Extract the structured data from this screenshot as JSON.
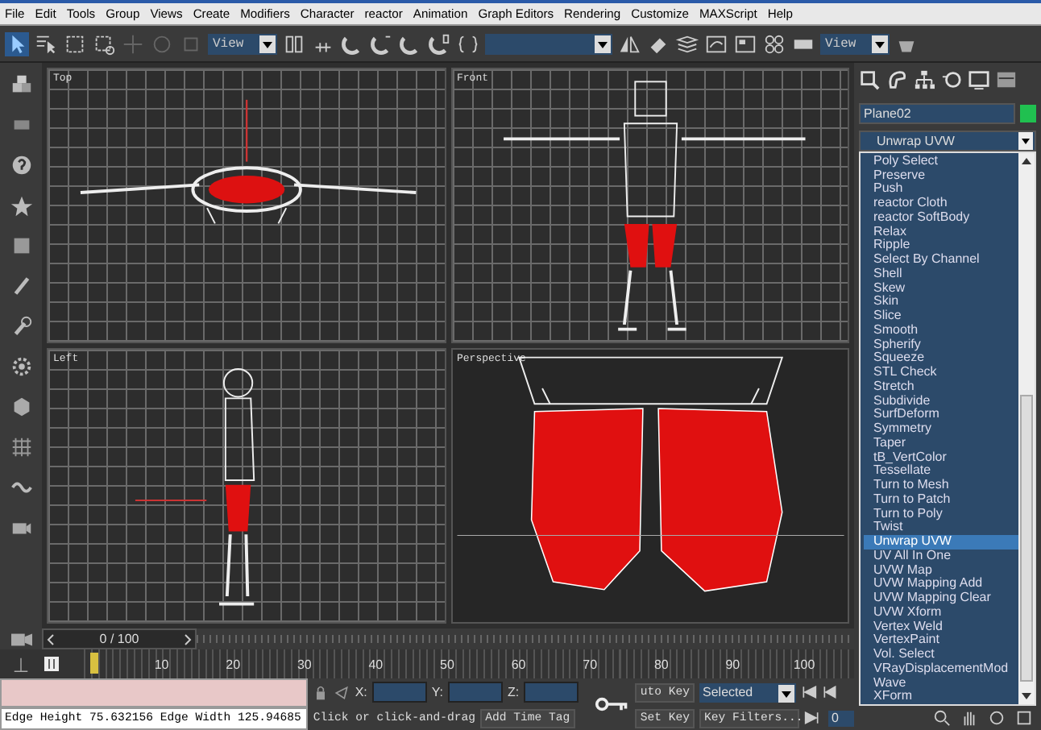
{
  "menu": [
    "File",
    "Edit",
    "Tools",
    "Group",
    "Views",
    "Create",
    "Modifiers",
    "Character",
    "reactor",
    "Animation",
    "Graph Editors",
    "Rendering",
    "Customize",
    "MAXScript",
    "Help"
  ],
  "toolbar": {
    "view_dropdowns": [
      "View",
      "View"
    ]
  },
  "viewports": [
    {
      "label": "Top",
      "kind": "top"
    },
    {
      "label": "Front",
      "kind": "front"
    },
    {
      "label": "Left",
      "kind": "left"
    },
    {
      "label": "Perspective",
      "kind": "perspective"
    }
  ],
  "time_slider": {
    "frame": "0 / 100",
    "level": 0
  },
  "track_ticks": [
    "10",
    "20",
    "30",
    "40",
    "50",
    "60",
    "70",
    "80",
    "90",
    "100"
  ],
  "command_panel": {
    "object_name": "Plane02",
    "modifier_dropdown": "Unwrap UVW",
    "modifier_list": [
      {
        "label": "Poly Select",
        "selected": false
      },
      {
        "label": "Preserve",
        "selected": false
      },
      {
        "label": "Push",
        "selected": false
      },
      {
        "label": "reactor Cloth",
        "selected": false
      },
      {
        "label": "reactor SoftBody",
        "selected": false
      },
      {
        "label": "Relax",
        "selected": false
      },
      {
        "label": "Ripple",
        "selected": false
      },
      {
        "label": "Select By Channel",
        "selected": false
      },
      {
        "label": "Shell",
        "selected": false
      },
      {
        "label": "Skew",
        "selected": false
      },
      {
        "label": "Skin",
        "selected": false
      },
      {
        "label": "Slice",
        "selected": false
      },
      {
        "label": "Smooth",
        "selected": false
      },
      {
        "label": "Spherify",
        "selected": false
      },
      {
        "label": "Squeeze",
        "selected": false
      },
      {
        "label": "STL Check",
        "selected": false
      },
      {
        "label": "Stretch",
        "selected": false
      },
      {
        "label": "Subdivide",
        "selected": false
      },
      {
        "label": "SurfDeform",
        "selected": false
      },
      {
        "label": "Symmetry",
        "selected": false
      },
      {
        "label": "Taper",
        "selected": false
      },
      {
        "label": "tB_VertColor",
        "selected": false
      },
      {
        "label": "Tessellate",
        "selected": false
      },
      {
        "label": "Turn to Mesh",
        "selected": false
      },
      {
        "label": "Turn to Patch",
        "selected": false
      },
      {
        "label": "Turn to Poly",
        "selected": false
      },
      {
        "label": "Twist",
        "selected": false
      },
      {
        "label": "Unwrap UVW",
        "selected": true
      },
      {
        "label": "UV All In One",
        "selected": false
      },
      {
        "label": "UVW Map",
        "selected": false
      },
      {
        "label": "UVW Mapping Add",
        "selected": false
      },
      {
        "label": "UVW Mapping Clear",
        "selected": false
      },
      {
        "label": "UVW Xform",
        "selected": false
      },
      {
        "label": "Vertex Weld",
        "selected": false
      },
      {
        "label": "VertexPaint",
        "selected": false
      },
      {
        "label": "Vol. Select",
        "selected": false
      },
      {
        "label": "VRayDisplacementMod",
        "selected": false
      },
      {
        "label": "Wave",
        "selected": false
      },
      {
        "label": "XForm",
        "selected": false
      }
    ]
  },
  "status": {
    "readout": "Edge Height 75.632156 Edge Width 125.94685",
    "prompt": "Click or click-and-drag",
    "coord_labels": [
      "X:",
      "Y:",
      "Z:"
    ],
    "add_time_tag": "Add Time Tag",
    "auto_key": "uto Key",
    "key_mode": "Selected",
    "set_key": "Set Key",
    "key_filters": "Key Filters...",
    "frame_field": "0"
  }
}
